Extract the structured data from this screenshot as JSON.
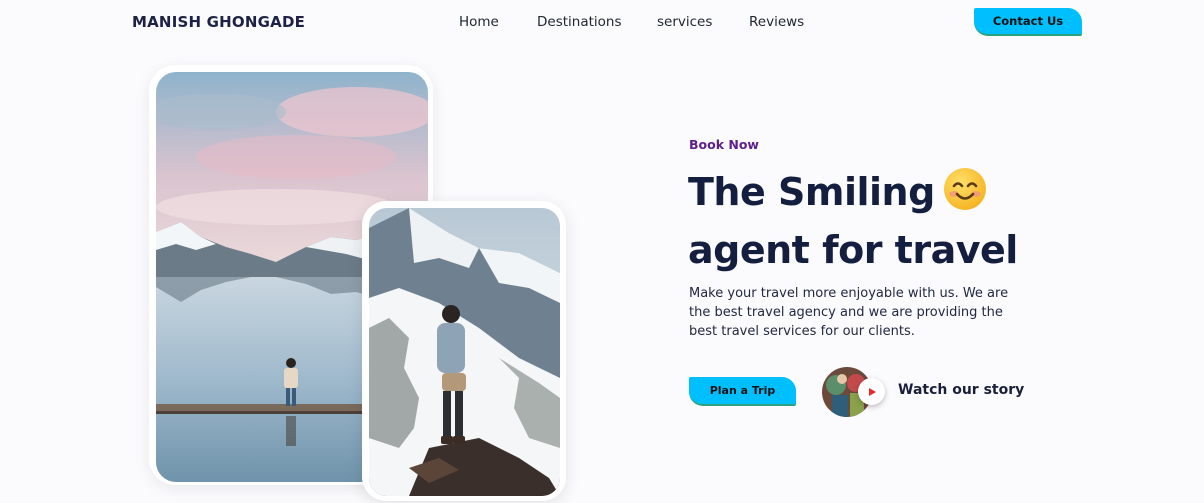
{
  "header": {
    "brand": "MANISH GHONGADE",
    "nav": [
      {
        "label": "Home"
      },
      {
        "label": "Destinations"
      },
      {
        "label": "services"
      },
      {
        "label": "Reviews"
      }
    ],
    "contact_label": "Contact Us"
  },
  "hero": {
    "eyebrow": "Book Now",
    "headline_line1": "The Smiling",
    "headline_line2": "agent for travel",
    "emoji_icon": "smiling-face-icon",
    "description": "Make your travel more enjoyable with us. We are the best travel agency and we are providing the best travel services for our clients.",
    "cta_label": "Plan a Trip",
    "story_label": "Watch our story"
  },
  "colors": {
    "accent": "#00bfff",
    "eyebrow": "#5c1f8c",
    "heading": "#141e3e",
    "background": "#fbfbfe",
    "play_icon": "#e8282b"
  }
}
